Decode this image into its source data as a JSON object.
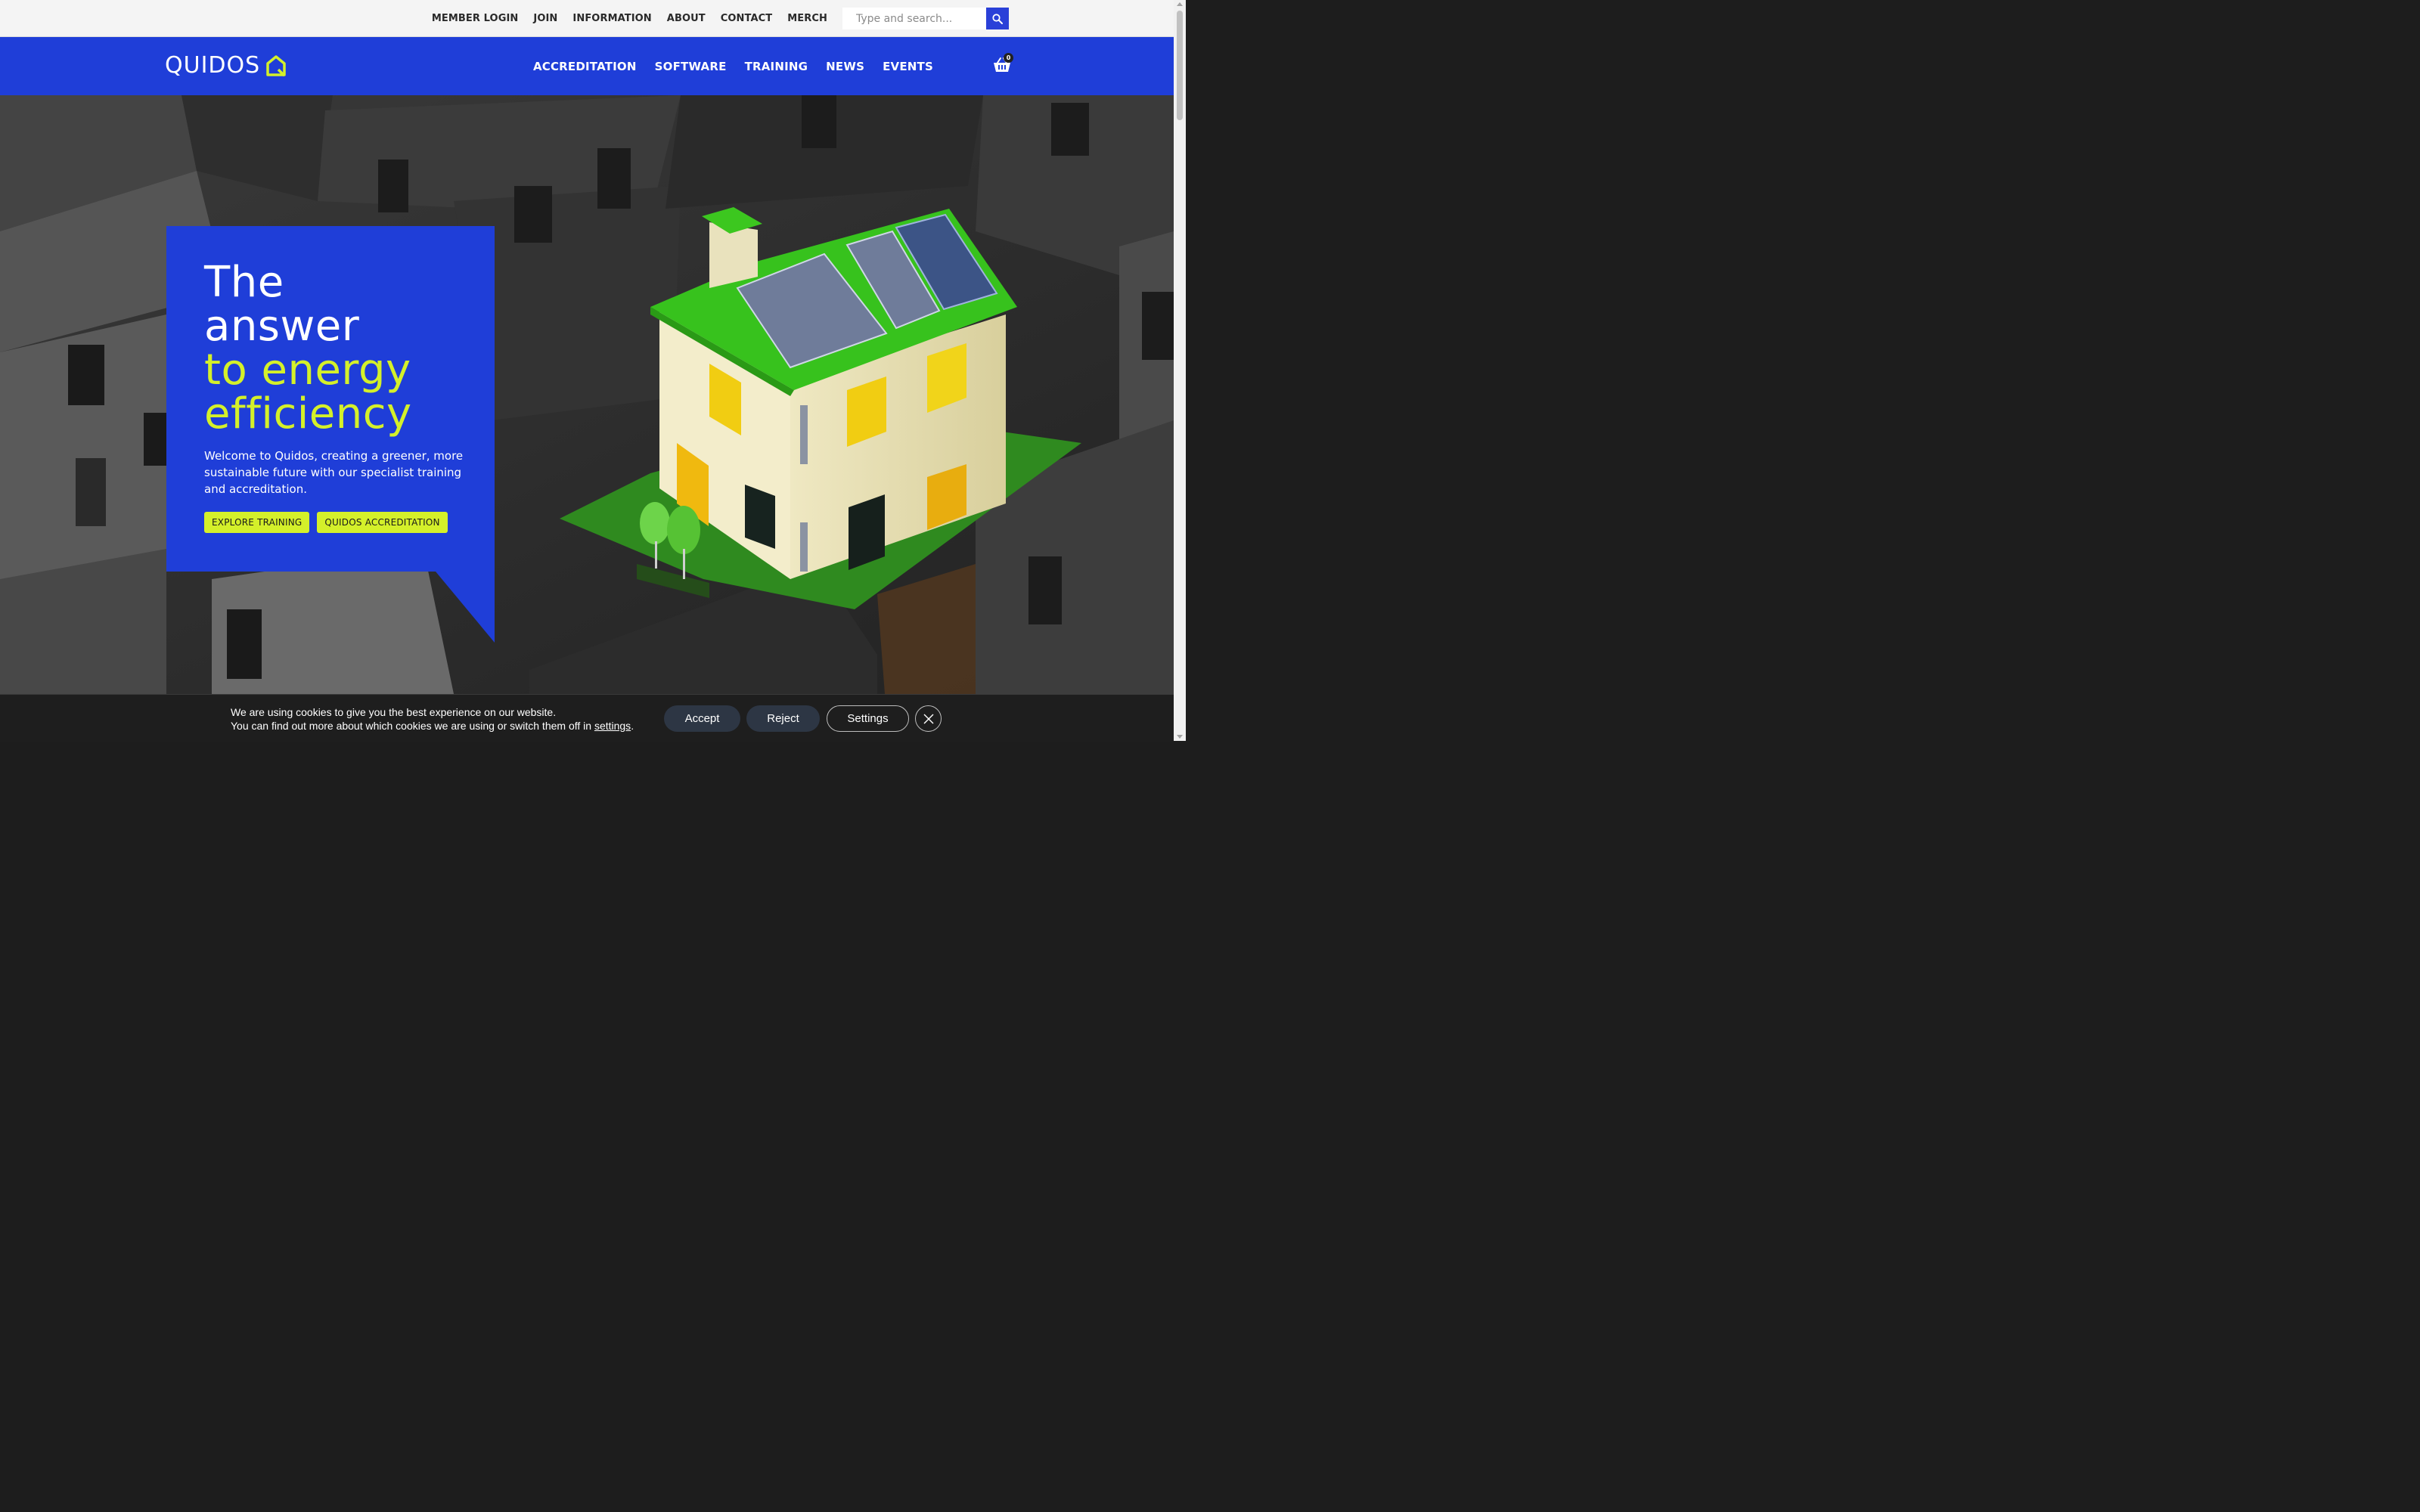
{
  "topbar": {
    "links": [
      "MEMBER LOGIN",
      "JOIN",
      "INFORMATION",
      "ABOUT",
      "CONTACT",
      "MERCH"
    ],
    "search": {
      "placeholder": "Type and search..."
    }
  },
  "header": {
    "logo_text": "QUIDOS",
    "nav": [
      "ACCREDITATION",
      "SOFTWARE",
      "TRAINING",
      "NEWS",
      "EVENTS"
    ],
    "cart_count": "0"
  },
  "hero": {
    "title_line1": "The",
    "title_line2": "answer",
    "title_line3": "to energy",
    "title_line4": "efficiency",
    "description": "Welcome to Quidos, creating a greener, more sustainable future with our specialist training and accreditation.",
    "buttons": [
      "EXPLORE TRAINING",
      "QUIDOS ACCREDITATION"
    ]
  },
  "cookie": {
    "line1": "We are using cookies to give you the best experience on our website.",
    "line2_prefix": "You can find out more about which cookies we are using or switch them off in ",
    "line2_link": "settings",
    "line2_suffix": ".",
    "accept": "Accept",
    "reject": "Reject",
    "settings": "Settings"
  },
  "colors": {
    "brand_blue": "#1f3ed8",
    "accent_green": "#d4f02a",
    "cookie_bg": "#1e1e1e"
  }
}
